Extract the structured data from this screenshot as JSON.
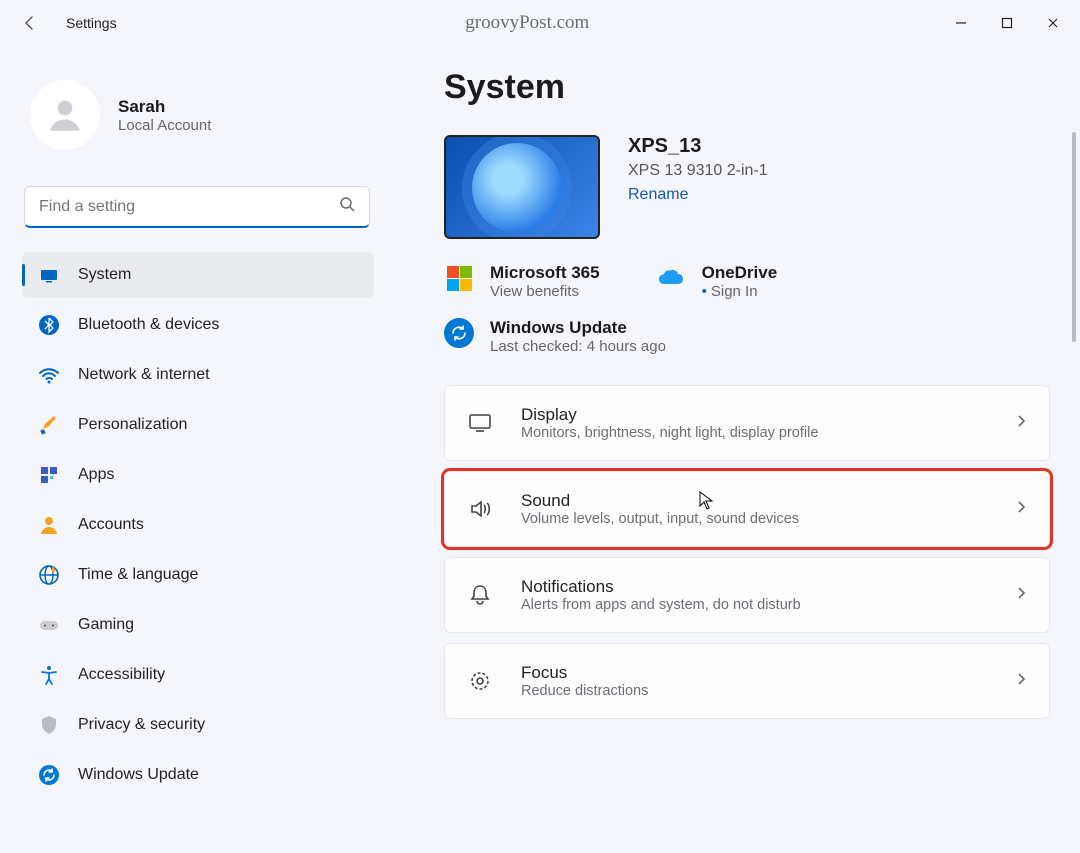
{
  "titlebar": {
    "app": "Settings",
    "watermark": "groovyPost.com"
  },
  "profile": {
    "name": "Sarah",
    "sub": "Local Account"
  },
  "search": {
    "placeholder": "Find a setting"
  },
  "nav": [
    {
      "label": "System",
      "icon": "system",
      "selected": true
    },
    {
      "label": "Bluetooth & devices",
      "icon": "bluetooth"
    },
    {
      "label": "Network & internet",
      "icon": "wifi"
    },
    {
      "label": "Personalization",
      "icon": "brush"
    },
    {
      "label": "Apps",
      "icon": "apps"
    },
    {
      "label": "Accounts",
      "icon": "person"
    },
    {
      "label": "Time & language",
      "icon": "globe"
    },
    {
      "label": "Gaming",
      "icon": "gamepad"
    },
    {
      "label": "Accessibility",
      "icon": "accessibility"
    },
    {
      "label": "Privacy & security",
      "icon": "shield"
    },
    {
      "label": "Windows Update",
      "icon": "sync"
    }
  ],
  "page": {
    "title": "System",
    "device": {
      "name": "XPS_13",
      "model": "XPS 13 9310 2-in-1",
      "rename": "Rename"
    },
    "cloud": {
      "m365": {
        "title": "Microsoft 365",
        "sub": "View benefits"
      },
      "onedrive": {
        "title": "OneDrive",
        "sub": "Sign In"
      }
    },
    "update": {
      "title": "Windows Update",
      "sub": "Last checked: 4 hours ago"
    },
    "cards": [
      {
        "title": "Display",
        "sub": "Monitors, brightness, night light, display profile",
        "icon": "display"
      },
      {
        "title": "Sound",
        "sub": "Volume levels, output, input, sound devices",
        "icon": "sound",
        "highlight": true,
        "cursor": true
      },
      {
        "title": "Notifications",
        "sub": "Alerts from apps and system, do not disturb",
        "icon": "bell"
      },
      {
        "title": "Focus",
        "sub": "Reduce distractions",
        "icon": "focus"
      }
    ]
  }
}
